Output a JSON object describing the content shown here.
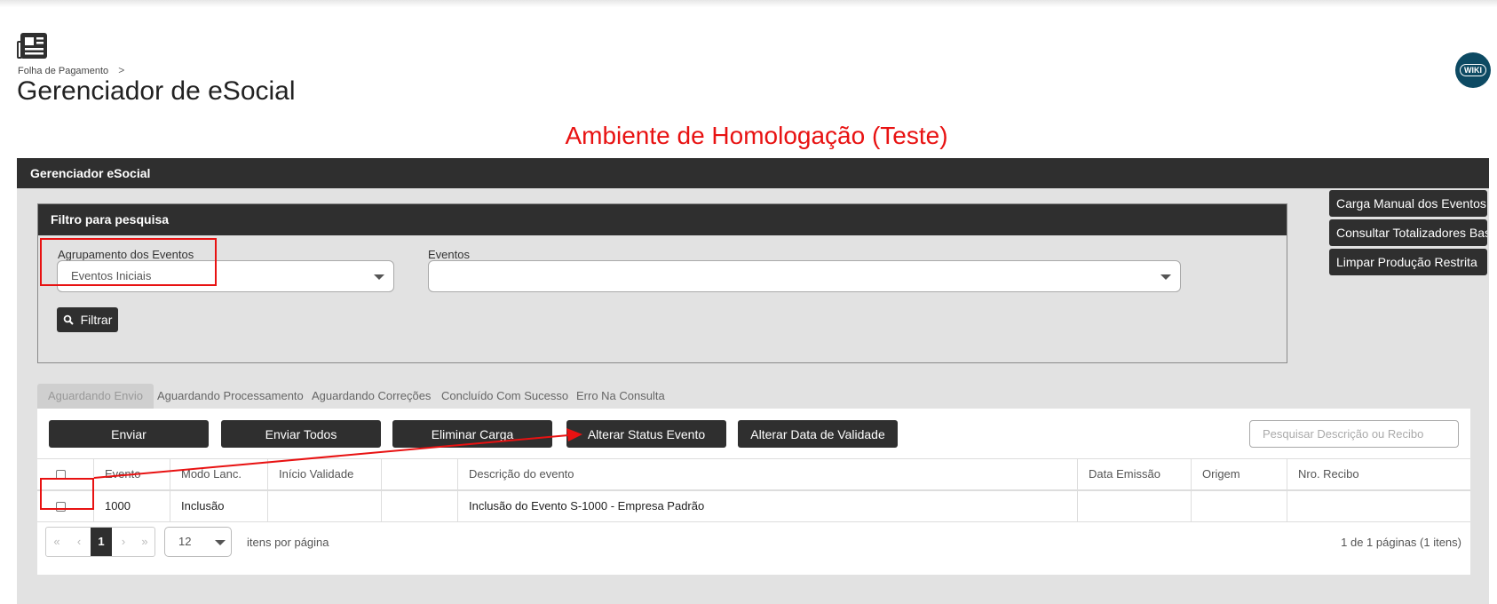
{
  "header": {
    "breadcrumb": "Folha de Pagamento",
    "breadcrumb_sep": ">",
    "title": "Gerenciador de eSocial",
    "wiki_label": "WIKI",
    "environment": "Ambiente de Homologação (Teste)"
  },
  "panel": {
    "title": "Gerenciador eSocial"
  },
  "filter": {
    "title": "Filtro para pesquisa",
    "group_label": "Agrupamento dos Eventos",
    "group_value": "Eventos Iniciais",
    "events_label": "Eventos",
    "events_value": "",
    "filter_button": "Filtrar"
  },
  "side_buttons": [
    "Carga Manual dos Eventos",
    "Consultar Totalizadores Base",
    "Limpar Produção Restrita"
  ],
  "tabs": [
    "Aguardando Envio",
    "Aguardando Processamento",
    "Aguardando Correções",
    "Concluído Com Sucesso",
    "Erro Na Consulta"
  ],
  "actions": [
    "Enviar",
    "Enviar Todos",
    "Eliminar Carga",
    "Alterar Status Evento",
    "Alterar Data de Validade"
  ],
  "search": {
    "placeholder": "Pesquisar Descrição ou Recibo"
  },
  "table": {
    "columns": [
      "Evento",
      "Modo Lanc.",
      "Início Validade",
      "",
      "Descrição do evento",
      "Data Emissão",
      "Origem",
      "Nro. Recibo"
    ],
    "rows": [
      [
        "1000",
        "Inclusão",
        "",
        "",
        "Inclusão do Evento S-1000 - Empresa Padrão",
        "",
        "",
        ""
      ]
    ]
  },
  "pagination": {
    "first": "«",
    "prev": "‹",
    "current": "1",
    "next": "›",
    "last": "»",
    "per_page": "12",
    "per_page_label": "itens por página",
    "info": "1 de 1 páginas (1 itens)"
  },
  "colors": {
    "dark": "#2f2f2f",
    "annotation": "#e81212",
    "panel_bg": "#e2e2e2",
    "wiki_bg": "#0d4a63"
  }
}
